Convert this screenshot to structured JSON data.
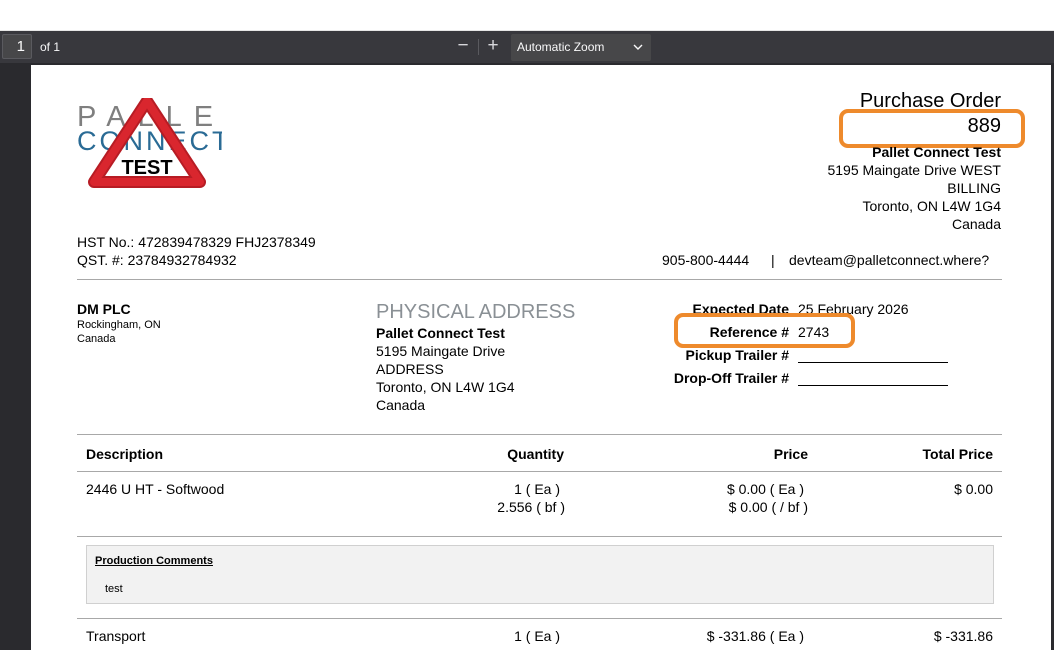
{
  "toolbar": {
    "page_number": "1",
    "page_count": "of 1",
    "zoom_out": "−",
    "zoom_in": "+",
    "zoom_level": "Automatic Zoom",
    "chevron": "⌄"
  },
  "logo": {
    "line1": "PALLET",
    "line2": "CONNECT",
    "badge": "TEST",
    "colors": {
      "triangle": "#d21f26",
      "connect": "#2a6b95",
      "pallet": "#7f7f7f"
    }
  },
  "po": {
    "title": "Purchase Order",
    "number": "889",
    "company": "Pallet Connect Test",
    "address1": "5195 Maingate Drive WEST",
    "address2": "BILLING",
    "city": "Toronto, ON L4W 1G4",
    "country": "Canada",
    "phone": "905-800-4444",
    "divider": "|",
    "email": "devteam@palletconnect.where?"
  },
  "tax": {
    "hst": "HST No.: 472839478329 FHJ2378349",
    "qst": "QST. #: 23784932784932"
  },
  "vendor": {
    "name": "DM PLC",
    "city": "Rockingham, ON",
    "country": "Canada"
  },
  "physical": {
    "heading": "PHYSICAL ADDRESS",
    "company": "Pallet Connect Test",
    "line1": "5195 Maingate Drive",
    "line2": "ADDRESS",
    "city": "Toronto, ON L4W 1G4",
    "country": "Canada"
  },
  "meta": {
    "expected_label": "Expected Date",
    "expected_value": "25 February 2026",
    "reference_label": "Reference #",
    "reference_value": "2743",
    "pickup_label": "Pickup Trailer #",
    "dropoff_label": "Drop-Off Trailer #"
  },
  "table": {
    "headers": [
      "Description",
      "Quantity",
      "Price",
      "Total Price"
    ],
    "rows": [
      {
        "description": "2446 U HT - Softwood",
        "qty1": "1 ( Ea )",
        "qty2": "2.556 ( bf )",
        "price1": "$ 0.00 ( Ea )",
        "price2": "$ 0.00 ( / bf )",
        "total": "$ 0.00"
      },
      {
        "description": "Transport",
        "qty1": "1 ( Ea )",
        "price1": "$ -331.86 ( Ea )",
        "total": "$ -331.86"
      }
    ]
  },
  "comments": {
    "title": "Production Comments",
    "text": "test"
  },
  "colors": {
    "highlight": "#ee8a2c",
    "toolbar": "#38383d",
    "viewer": "#2a2a2e"
  }
}
